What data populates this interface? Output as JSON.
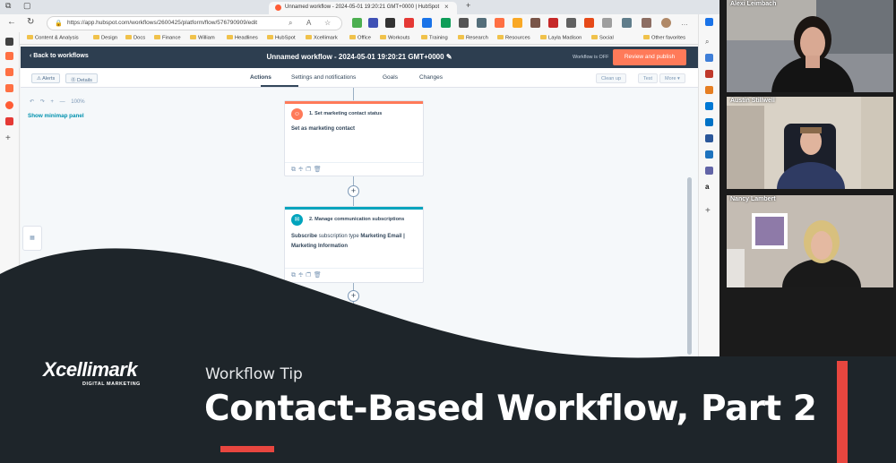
{
  "browser": {
    "tab_title": "Unnamed workflow - 2024-05-01 19:20:21 GMT+0000 | HubSpot",
    "url": "https://app.hubspot.com/workflows/2600425/platform/flow/576790909/edit",
    "bookmarks": [
      "Content & Analysis",
      "Design",
      "Docs",
      "Finance",
      "William",
      "Headlines",
      "HubSpot",
      "Xcellimark",
      "Office",
      "Workouts",
      "Training",
      "Research",
      "Resources",
      "Layla Madison",
      "Social",
      "Other favorites"
    ]
  },
  "workflow": {
    "back_label": "Back to workflows",
    "title": "Unnamed workflow - 2024-05-01 19:20:21 GMT+0000",
    "status_label": "Workflow is OFF",
    "review_button": "Review and publish",
    "alerts_pill": "Alerts",
    "details_pill": "Details",
    "tabs": [
      "Actions",
      "Settings and notifications",
      "Goals",
      "Changes"
    ],
    "clean_up": "Clean up",
    "test": "Test",
    "more": "More",
    "zoom_level": "100%",
    "minimap_link": "Show minimap panel",
    "actions": [
      {
        "title": "1. Set marketing contact status",
        "body": "Set as marketing contact",
        "color": "#ff7a59",
        "icon": "contact-icon"
      },
      {
        "title": "2. Manage communication subscriptions",
        "body_prefix": "Subscribe",
        "body_mid": "subscription type",
        "body_value": "Marketing Email | Marketing Information",
        "color": "#00a4bd",
        "icon": "subscription-icon"
      }
    ]
  },
  "participants": [
    "Alexi Leimbach",
    "Austin Stillwell",
    "Nancy Lambert"
  ],
  "overlay": {
    "brand": "Xcellimark",
    "brand_sub": "DIGITAL MARKETING",
    "tip_label": "Workflow Tip",
    "headline": "Contact-Based Workflow, Part 2",
    "accent_color": "#e8463f",
    "background_color": "#1e252a"
  }
}
